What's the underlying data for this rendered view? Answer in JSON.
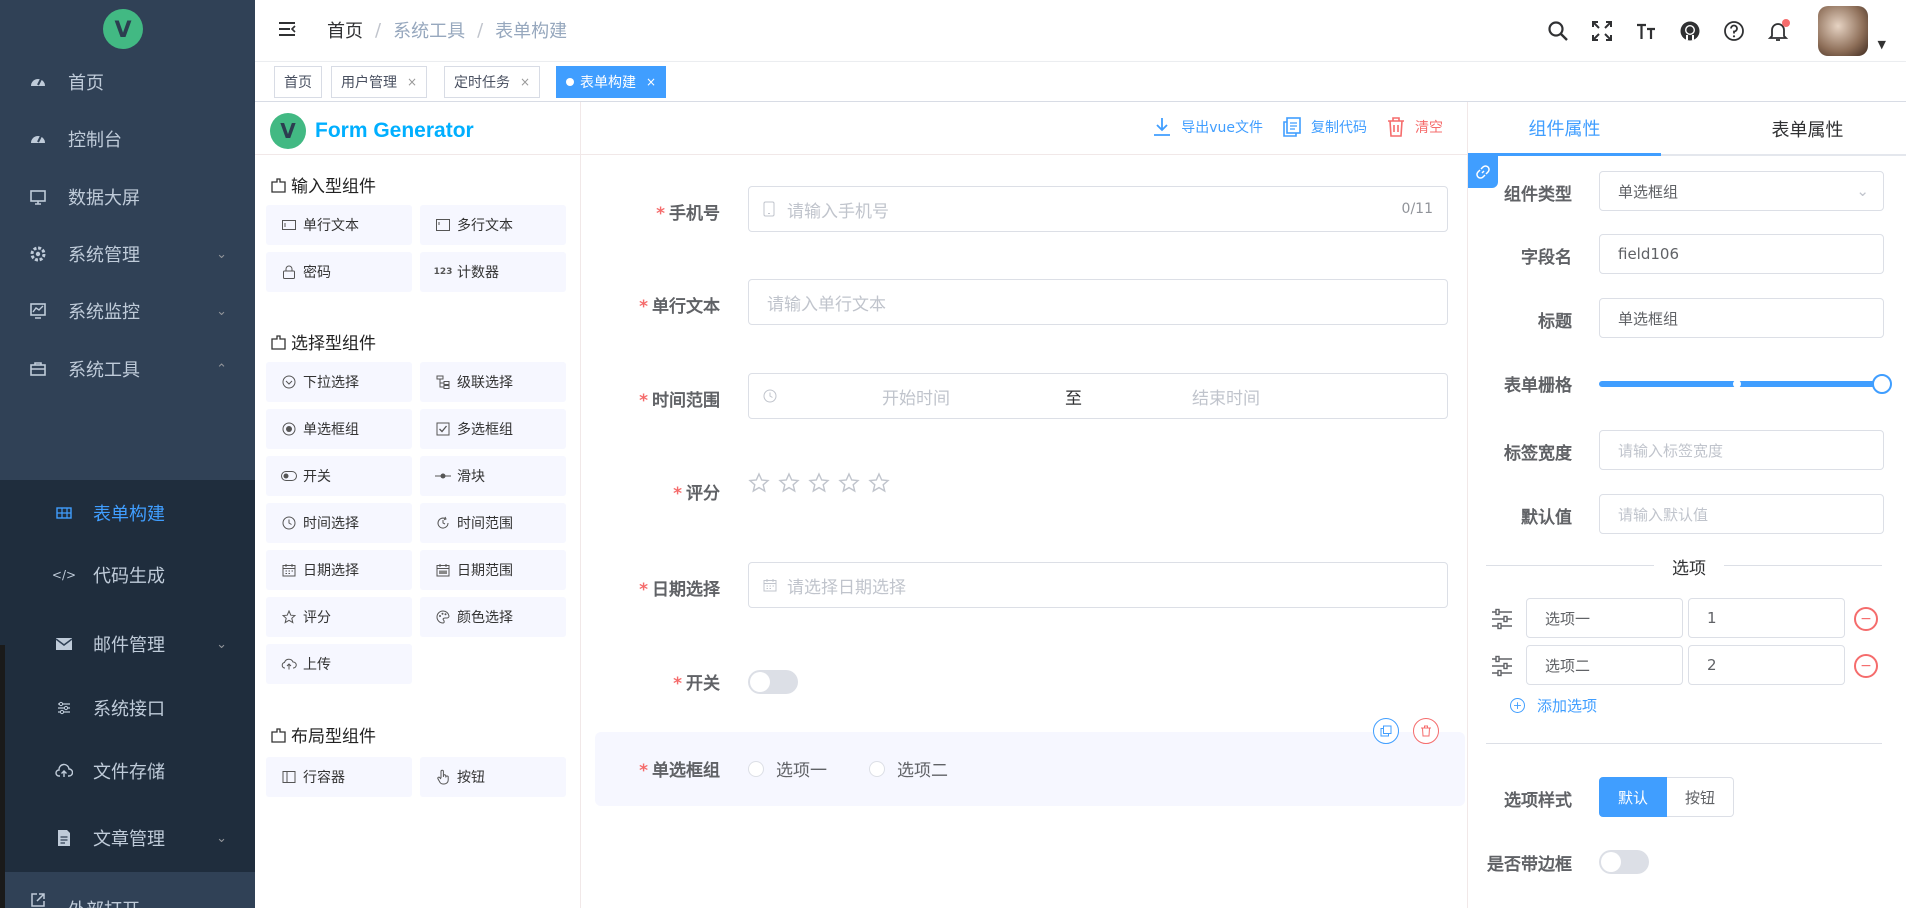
{
  "sidebar": {
    "logo_letter": "V",
    "items": [
      {
        "label": "首页",
        "icon": "dashboard-icon"
      },
      {
        "label": "控制台",
        "icon": "dashboard-icon"
      },
      {
        "label": "数据大屏",
        "icon": "monitor-icon"
      },
      {
        "label": "系统管理",
        "icon": "gear-icon"
      },
      {
        "label": "系统监控",
        "icon": "monitor-chart-icon"
      },
      {
        "label": "系统工具",
        "icon": "toolbox-icon"
      }
    ],
    "subitems": [
      {
        "label": "表单构建",
        "icon": "table-grid-icon",
        "active": true
      },
      {
        "label": "代码生成",
        "icon": "code-icon"
      },
      {
        "label": "邮件管理",
        "icon": "mail-icon"
      },
      {
        "label": "系统接口",
        "icon": "sliders-icon"
      },
      {
        "label": "文件存储",
        "icon": "cloud-upload-icon"
      },
      {
        "label": "文章管理",
        "icon": "document-icon"
      }
    ],
    "bottom_item": {
      "label": "外部打开",
      "icon": "external-link-icon"
    }
  },
  "header": {
    "breadcrumb": [
      "首页",
      "系统工具",
      "表单构建"
    ],
    "icons": [
      "search-icon",
      "fullscreen-icon",
      "font-size-icon",
      "github-icon",
      "help-icon",
      "bell-icon"
    ]
  },
  "tags": [
    {
      "label": "首页",
      "closable": false
    },
    {
      "label": "用户管理",
      "closable": true
    },
    {
      "label": "定时任务",
      "closable": true
    },
    {
      "label": "表单构建",
      "closable": true,
      "active": true
    }
  ],
  "generator": {
    "title": "Form Generator",
    "logo_letter": "V",
    "actions": {
      "export": "导出vue文件",
      "copy": "复制代码",
      "clear": "清空"
    }
  },
  "components": {
    "groups": [
      {
        "title": "输入型组件",
        "items": [
          {
            "label": "单行文本",
            "icon": "input-icon"
          },
          {
            "label": "多行文本",
            "icon": "textarea-icon"
          },
          {
            "label": "密码",
            "icon": "lock-icon"
          },
          {
            "label": "计数器",
            "icon": "number-icon",
            "glyph": "123"
          }
        ]
      },
      {
        "title": "选择型组件",
        "items": [
          {
            "label": "下拉选择",
            "icon": "select-icon"
          },
          {
            "label": "级联选择",
            "icon": "cascader-icon"
          },
          {
            "label": "单选框组",
            "icon": "radio-icon"
          },
          {
            "label": "多选框组",
            "icon": "checkbox-icon"
          },
          {
            "label": "开关",
            "icon": "switch-icon"
          },
          {
            "label": "滑块",
            "icon": "slider-icon"
          },
          {
            "label": "时间选择",
            "icon": "clock-icon"
          },
          {
            "label": "时间范围",
            "icon": "time-range-icon"
          },
          {
            "label": "日期选择",
            "icon": "calendar-icon"
          },
          {
            "label": "日期范围",
            "icon": "date-range-icon"
          },
          {
            "label": "评分",
            "icon": "star-icon"
          },
          {
            "label": "颜色选择",
            "icon": "palette-icon"
          },
          {
            "label": "上传",
            "icon": "upload-icon"
          }
        ]
      },
      {
        "title": "布局型组件",
        "items": [
          {
            "label": "行容器",
            "icon": "row-icon"
          },
          {
            "label": "按钮",
            "icon": "hand-icon"
          }
        ]
      }
    ]
  },
  "form": {
    "phone": {
      "label": "手机号",
      "placeholder": "请输入手机号",
      "count": "0/11"
    },
    "single_text": {
      "label": "单行文本",
      "placeholder": "请输入单行文本"
    },
    "time_range": {
      "label": "时间范围",
      "start": "开始时间",
      "sep": "至",
      "end": "结束时间"
    },
    "rate": {
      "label": "评分",
      "stars": 5,
      "value": 0
    },
    "date": {
      "label": "日期选择",
      "placeholder": "请选择日期选择"
    },
    "switch": {
      "label": "开关",
      "on": false
    },
    "radio": {
      "label": "单选框组",
      "options": [
        "选项一",
        "选项二"
      ]
    },
    "required_mark": "*"
  },
  "props": {
    "tabs": [
      "组件属性",
      "表单属性"
    ],
    "component_type": {
      "label": "组件类型",
      "value": "单选框组"
    },
    "field_name": {
      "label": "字段名",
      "value": "field106"
    },
    "title": {
      "label": "标题",
      "value": "单选框组"
    },
    "span": {
      "label": "表单栅格",
      "value": 24,
      "max": 24
    },
    "label_width": {
      "label": "标签宽度",
      "placeholder": "请输入标签宽度"
    },
    "default_value": {
      "label": "默认值",
      "placeholder": "请输入默认值"
    },
    "options_section": "选项",
    "options": [
      {
        "label": "选项一",
        "value": "1"
      },
      {
        "label": "选项二",
        "value": "2"
      }
    ],
    "add_option": "添加选项",
    "option_style": {
      "label": "选项样式",
      "choices": [
        "默认",
        "按钮"
      ],
      "selected": "默认"
    },
    "border": {
      "label": "是否带边框",
      "on": false
    }
  },
  "colors": {
    "accent": "#409eff",
    "sidebar": "#304156",
    "danger": "#f56c6c"
  }
}
